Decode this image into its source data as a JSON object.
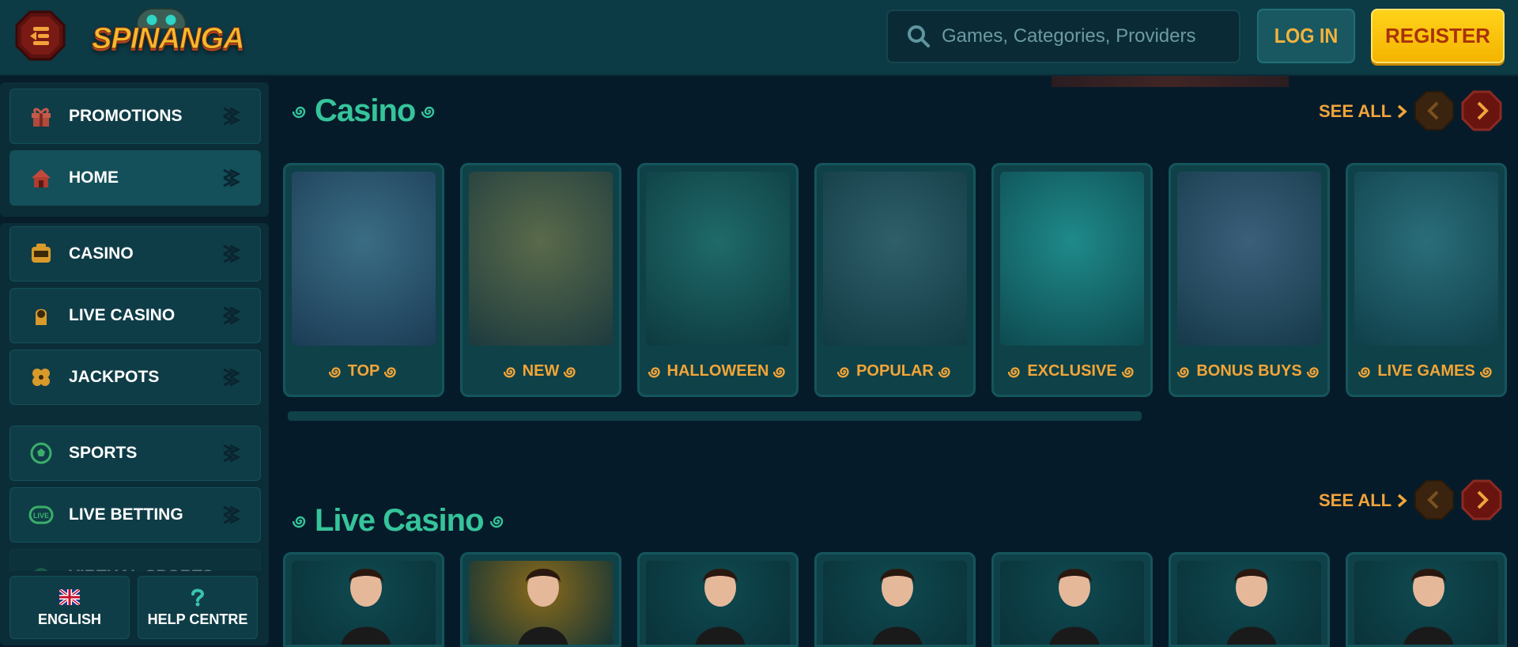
{
  "header": {
    "logo_text": "SPINANGA",
    "search_placeholder": "Games, Categories, Providers",
    "login_label": "LOG IN",
    "register_label": "REGISTER"
  },
  "sidebar": {
    "items": [
      {
        "label": "PROMOTIONS",
        "icon": "gift-icon"
      },
      {
        "label": "HOME",
        "icon": "home-icon"
      },
      {
        "label": "CASINO",
        "icon": "slot-machine-icon"
      },
      {
        "label": "LIVE CASINO",
        "icon": "dealer-icon"
      },
      {
        "label": "JACKPOTS",
        "icon": "clover-icon"
      },
      {
        "label": "SPORTS",
        "icon": "football-icon"
      },
      {
        "label": "LIVE BETTING",
        "icon": "live-icon"
      },
      {
        "label": "VIRTUAL SPORTS",
        "icon": "virtual-icon"
      }
    ],
    "bottom": {
      "language_label": "ENGLISH",
      "help_label": "HELP CENTRE"
    }
  },
  "casino": {
    "title": "Casino",
    "see_all": "SEE ALL",
    "categories": [
      {
        "label": "TOP",
        "art_colors": [
          "#3a6d85",
          "#1c3c55"
        ]
      },
      {
        "label": "NEW",
        "art_colors": [
          "#5a6a4a",
          "#1d3a3e"
        ]
      },
      {
        "label": "HALLOWEEN",
        "art_colors": [
          "#1f6a6a",
          "#0d3a3f"
        ]
      },
      {
        "label": "POPULAR",
        "art_colors": [
          "#2f5f6a",
          "#113a44"
        ]
      },
      {
        "label": "EXCLUSIVE",
        "art_colors": [
          "#1f8a8a",
          "#0d4a50"
        ]
      },
      {
        "label": "BONUS BUYS",
        "art_colors": [
          "#3b5f7a",
          "#163a4a"
        ]
      },
      {
        "label": "LIVE GAMES",
        "art_colors": [
          "#2a6e7a",
          "#0f3f4a"
        ]
      }
    ]
  },
  "live_casino": {
    "title": "Live Casino",
    "see_all": "SEE ALL"
  },
  "colors": {
    "accent_green": "#36c49a",
    "accent_orange": "#f1a43a",
    "register_yellow": "#ffd21a"
  }
}
